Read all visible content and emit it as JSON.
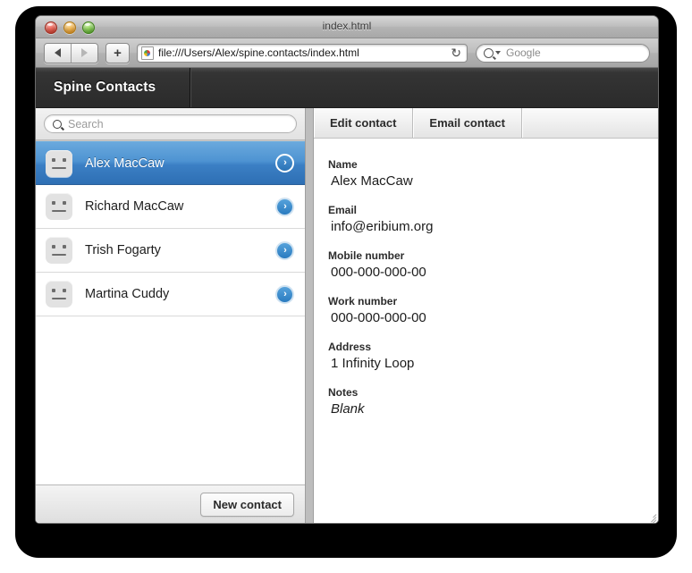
{
  "window": {
    "title": "index.html",
    "traffic_lights": [
      "close",
      "minimize",
      "zoom"
    ]
  },
  "browser_toolbar": {
    "back_label": "◀",
    "forward_label": "▶",
    "add_tab_label": "+",
    "url": "file:///Users/Alex/spine.contacts/index.html",
    "reload_label": "↻",
    "search_placeholder": "Google"
  },
  "app": {
    "brand": "Spine Contacts"
  },
  "sidebar": {
    "search_placeholder": "Search",
    "contacts": [
      {
        "name": "Alex MacCaw",
        "selected": true
      },
      {
        "name": "Richard MacCaw",
        "selected": false
      },
      {
        "name": "Trish Fogarty",
        "selected": false
      },
      {
        "name": "Martina Cuddy",
        "selected": false
      }
    ],
    "new_contact_label": "New contact"
  },
  "detail": {
    "tabs": [
      {
        "label": "Edit contact"
      },
      {
        "label": "Email contact"
      }
    ],
    "fields": [
      {
        "label": "Name",
        "value": "Alex MacCaw",
        "italic": false
      },
      {
        "label": "Email",
        "value": "info@eribium.org",
        "italic": false
      },
      {
        "label": "Mobile number",
        "value": "000-000-000-00",
        "italic": false
      },
      {
        "label": "Work number",
        "value": "000-000-000-00",
        "italic": false
      },
      {
        "label": "Address",
        "value": "1 Infinity Loop",
        "italic": false
      },
      {
        "label": "Notes",
        "value": "Blank",
        "italic": true
      }
    ]
  },
  "colors": {
    "selection_blue": "#3b7fc4",
    "badge_blue": "#2a7bc0",
    "app_header_dark": "#2b2b2b"
  }
}
